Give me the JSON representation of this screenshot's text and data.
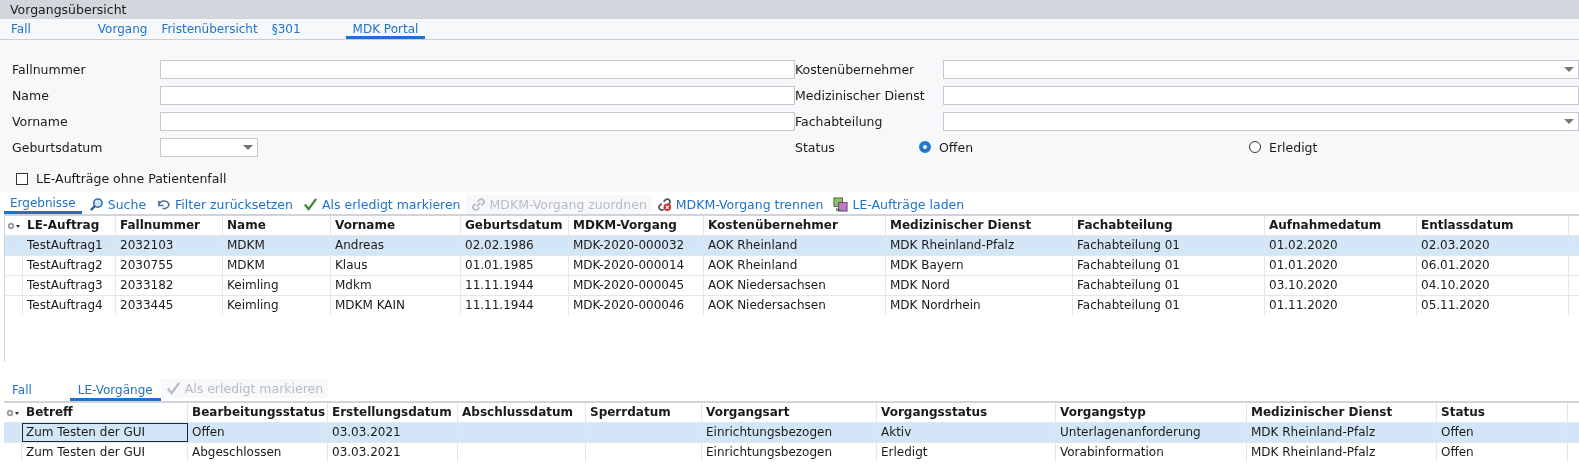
{
  "window": {
    "title": "Vorgangsübersicht"
  },
  "tabs": [
    {
      "label": "Fall",
      "selected": false
    },
    {
      "label": "Vorgang",
      "selected": false
    },
    {
      "label": "Fristenübersicht",
      "selected": false
    },
    {
      "label": "§301",
      "selected": false
    },
    {
      "label": "MDK Portal",
      "selected": true
    }
  ],
  "filter": {
    "left": [
      {
        "label": "Fallnummer",
        "kind": "text"
      },
      {
        "label": "Name",
        "kind": "text"
      },
      {
        "label": "Vorname",
        "kind": "text"
      },
      {
        "label": "Geburtsdatum",
        "kind": "date"
      }
    ],
    "right": [
      {
        "label": "Kostenübernehmer",
        "kind": "dropdown"
      },
      {
        "label": "Medizinischer Dienst",
        "kind": "text"
      },
      {
        "label": "Fachabteilung",
        "kind": "dropdown"
      }
    ],
    "status": {
      "label": "Status",
      "options": [
        {
          "label": "Offen",
          "selected": true
        },
        {
          "label": "Erledigt",
          "selected": false
        }
      ]
    },
    "checkbox": {
      "label": "LE-Aufträge ohne Patientenfall",
      "checked": false
    }
  },
  "results": {
    "tab": {
      "label": "Ergebnisse",
      "selected": true
    },
    "toolbar": [
      {
        "label": "Suche",
        "kind": "search",
        "disabled": false
      },
      {
        "label": "Filter zurücksetzen",
        "kind": "reset",
        "disabled": false
      },
      {
        "label": "Als erledigt markieren",
        "kind": "check",
        "disabled": false
      },
      {
        "label": "MDKM-Vorgang zuordnen",
        "kind": "link",
        "disabled": true
      },
      {
        "label": "MDKM-Vorgang trennen",
        "kind": "unlink",
        "disabled": false
      },
      {
        "label": "LE-Aufträge laden",
        "kind": "load",
        "disabled": false
      }
    ],
    "table": {
      "columns": [
        "LE-Auftrag",
        "Fallnummer",
        "Name",
        "Vorname",
        "Geburtsdatum",
        "MDKM-Vorgang",
        "Kostenübernehmer",
        "Medizinischer Dienst",
        "Fachabteilung",
        "Aufnahmedatum",
        "Entlassdatum"
      ],
      "rows": [
        {
          "selected": true,
          "focused": false,
          "cells": [
            "TestAuftrag1",
            "2032103",
            "MDKM",
            "Andreas",
            "02.02.1986",
            "MDK-2020-000032",
            "AOK Rheinland",
            "MDK Rheinland-Pfalz",
            "Fachabteilung 01",
            "01.02.2020",
            "02.03.2020"
          ]
        },
        {
          "selected": false,
          "focused": false,
          "cells": [
            "TestAuftrag2",
            "2030755",
            "MDKM",
            "Klaus",
            "01.01.1985",
            "MDK-2020-000014",
            "AOK Rheinland",
            "MDK Bayern",
            "Fachabteilung 01",
            "01.01.2020",
            "06.01.2020"
          ]
        },
        {
          "selected": false,
          "focused": false,
          "cells": [
            "TestAuftrag3",
            "2033182",
            "Keimling",
            "Mdkm",
            "11.11.1944",
            "MDK-2020-000045",
            "AOK Niedersachsen",
            "MDK Nord",
            "Fachabteilung 01",
            "03.10.2020",
            "04.10.2020"
          ]
        },
        {
          "selected": false,
          "focused": false,
          "cells": [
            "TestAuftrag4",
            "2033445",
            "Keimling",
            "MDKM KAIN",
            "11.11.1944",
            "MDK-2020-000046",
            "AOK Niedersachsen",
            "MDK Nordrhein",
            "Fachabteilung 01",
            "01.11.2020",
            "05.11.2020"
          ]
        }
      ]
    }
  },
  "detail": {
    "tabs": [
      {
        "label": "Fall",
        "selected": false
      },
      {
        "label": "LE-Vorgänge",
        "selected": true
      }
    ],
    "toolbar": [
      {
        "label": "Als erledigt markieren",
        "kind": "check",
        "disabled": true
      }
    ],
    "table": {
      "columns": [
        "Betreff",
        "Bearbeitungsstatus",
        "Erstellungsdatum",
        "Abschlussdatum",
        "Sperrdatum",
        "Vorgangsart",
        "Vorgangsstatus",
        "Vorgangstyp",
        "Medizinischer Dienst",
        "Status"
      ],
      "rows": [
        {
          "selected": true,
          "focused": true,
          "cells": [
            "Zum Testen der GUI",
            "Offen",
            "03.03.2021",
            "",
            "",
            "Einrichtungsbezogen",
            "Aktiv",
            "Unterlagenanforderung",
            "MDK Rheinland-Pfalz",
            "Offen"
          ]
        },
        {
          "selected": false,
          "focused": false,
          "cells": [
            "Zum Testen der GUI",
            "Abgeschlossen",
            "03.03.2021",
            "",
            "",
            "Einrichtungsbezogen",
            "Erledigt",
            "Vorabinformation",
            "MDK Rheinland-Pfalz",
            "Offen"
          ]
        }
      ]
    }
  }
}
